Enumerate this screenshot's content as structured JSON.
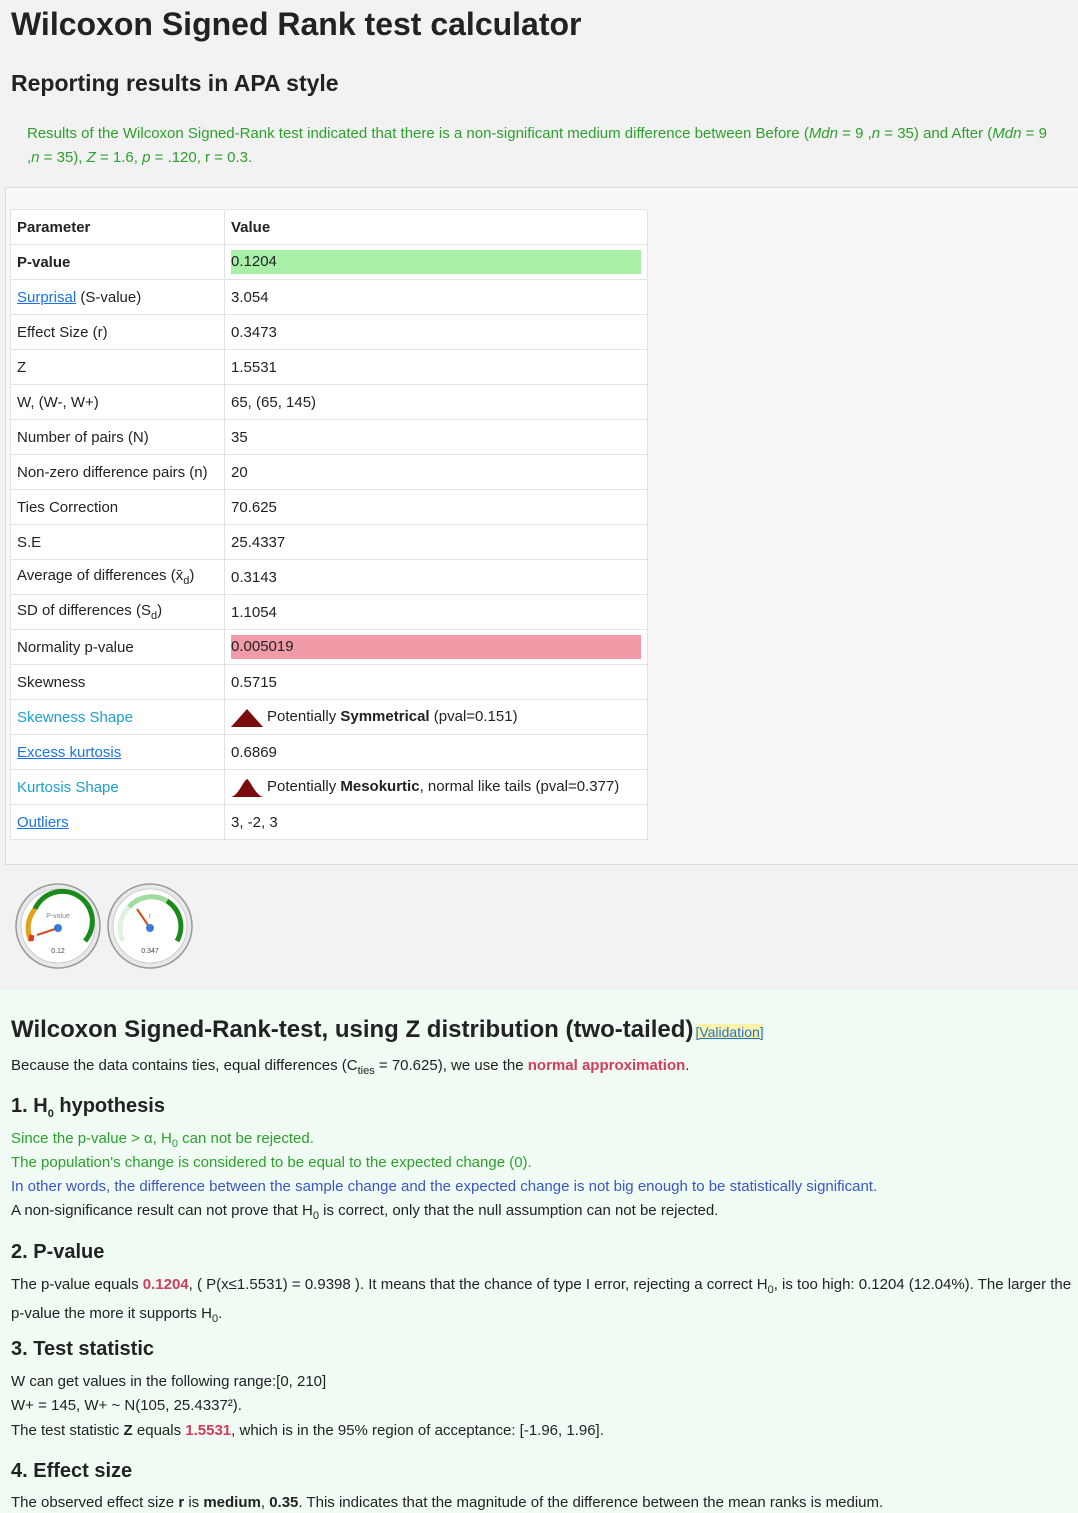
{
  "title": "Wilcoxon Signed Rank test calculator",
  "subtitle": "Reporting results in APA style",
  "apa": {
    "p1": "Results of the Wilcoxon Signed-Rank test indicated that there is a non-significant medium difference between Before (",
    "mdn": "Mdn",
    "p2": " = 9 ,",
    "n": "n",
    "p3": " = 35) and After (",
    "p4": " = 9 ,",
    "p5": " = 35), ",
    "z": "Z",
    "p6": " = 1.6, ",
    "p": "p",
    "p7": " = .120, r = 0.3."
  },
  "table": {
    "headers": [
      "Parameter",
      "Value"
    ],
    "rows": [
      {
        "param": "P-value",
        "value": "0.1204"
      },
      {
        "param_link": "Surprisal",
        "param_rest": " (S-value)",
        "value": "3.054"
      },
      {
        "param": "Effect Size (r)",
        "value": "0.3473"
      },
      {
        "param": "Z",
        "value": "1.5531"
      },
      {
        "param": "W, (W-, W+)",
        "value": "65, (65, 145)"
      },
      {
        "param": "Number of pairs (N)",
        "value": "35"
      },
      {
        "param": "Non-zero difference pairs (n)",
        "value": "20"
      },
      {
        "param": "Ties Correction",
        "value": "70.625"
      },
      {
        "param": "S.E",
        "value": "25.4337"
      },
      {
        "param": "Average of differences (x̄",
        "sub": "d",
        "param_end": ")",
        "value": "0.3143"
      },
      {
        "param": "SD of differences (S",
        "sub": "d",
        "param_end": ")",
        "value": "1.1054"
      },
      {
        "param": "Normality p-value",
        "value": "0.005019"
      },
      {
        "param": "Skewness",
        "value": "0.5715"
      },
      {
        "param": "Skewness Shape",
        "value_a": "Potentially ",
        "value_b": "Symmetrical",
        "value_c": " (pval=0.151)"
      },
      {
        "param": "Excess kurtosis",
        "value": "0.6869"
      },
      {
        "param": "Kurtosis Shape",
        "value_a": "Potentially ",
        "value_b": "Mesokurtic",
        "value_c": ", normal like tails (pval=0.377)"
      },
      {
        "param": "Outliers",
        "value": "3, -2, 3"
      }
    ]
  },
  "gauges": [
    {
      "label": "P-value",
      "value_text": "0.12",
      "value": 0.12
    },
    {
      "label": "r",
      "value_text": "0.347",
      "value": 0.347
    }
  ],
  "results": {
    "title": "Wilcoxon Signed-Rank-test, using Z distribution (two-tailed)",
    "validation": "[Validation]",
    "ties_a": "Because the data contains ties, equal differences (C",
    "ties_sub": "ties",
    "ties_b": " = 70.625), we use the ",
    "ties_c": "normal approximation",
    "ties_d": ".",
    "h1": "1. H",
    "h1_sub": "0",
    "h1_rest": " hypothesis",
    "s1_a": "Since the p-value > α, H",
    "s1_sub": "0",
    "s1_b": " can not be rejected.",
    "s2": "The population's change is considered to be equal to the expected change (0).",
    "s3": "In other words, the difference between the sample change and the expected change is not big enough to be statistically significant.",
    "s4_a": "A non-significance result can not prove that H",
    "s4_sub": "0",
    "s4_b": " is correct, only that the null assumption can not be rejected.",
    "h2": "2. P-value",
    "p_a": "The p-value equals ",
    "p_val": "0.1204",
    "p_b": ", ( P(x≤1.5531) = 0.9398 ). It means that the chance of type I error, rejecting a correct H",
    "p_sub": "0",
    "p_c": ", is too high: 0.1204 (12.04%). The larger the p-value the more it supports H",
    "p_sub2": "0",
    "p_d": ".",
    "h3": "3. Test statistic",
    "t1": "W can get values in the following range:[0, 210]",
    "t2": "W+ = 145, W+ ~ N(105, 25.4337²).",
    "t3_a": "The test statistic ",
    "t3_z": "Z",
    "t3_b": " equals ",
    "t3_val": "1.5531",
    "t3_c": ", which is in the 95% region of acceptance: [-1.96, 1.96].",
    "h4": "4. Effect size",
    "e_a": "The observed effect size ",
    "e_r": "r",
    "e_b": " is ",
    "e_m": "medium",
    "e_c": ", ",
    "e_v": "0.35",
    "e_d": ". This indicates that the magnitude of the difference between the mean ranks is medium."
  },
  "colors": {
    "significant_green": "#a8f0a8",
    "normality_red": "#f19aa8",
    "accent_red": "#d33c5a"
  }
}
